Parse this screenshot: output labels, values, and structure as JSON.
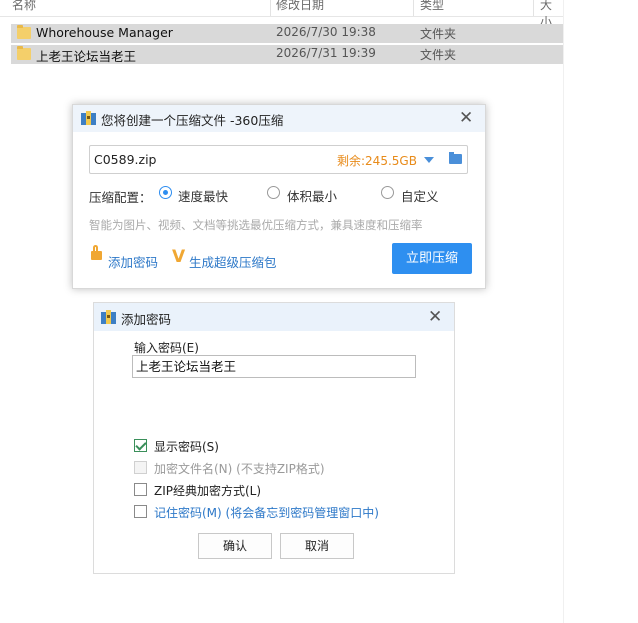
{
  "explorer": {
    "columns": [
      "名称",
      "修改日期",
      "类型",
      "大小"
    ],
    "rows": [
      {
        "name": "Whorehouse Manager",
        "date": "2026/7/30 19:38",
        "type": "文件夹"
      },
      {
        "name": "上老王论坛当老王",
        "date": "2026/7/31 19:39",
        "type": "文件夹"
      }
    ]
  },
  "compress_dialog": {
    "title": "您将创建一个压缩文件 -360压缩",
    "filename": "C0589.zip",
    "free_space": "剩余:245.5GB",
    "config_label": "压缩配置：",
    "options": [
      "速度最快",
      "体积最小",
      "自定义"
    ],
    "selected_option": "速度最快",
    "hint": "智能为图片、视频、文档等挑选最优压缩方式，兼具速度和压缩率",
    "add_password_link": "添加密码",
    "super_package_link": "生成超级压缩包",
    "compress_button": "立即压缩",
    "accent_color": "#2e8ff0",
    "warning_color": "#e88b1a"
  },
  "password_dialog": {
    "title": "添加密码",
    "input_label": "输入密码(E)",
    "password_value": "上老王论坛当老王",
    "checkboxes": [
      {
        "label": "显示密码(S)",
        "checked": true,
        "disabled": false
      },
      {
        "label": "加密文件名(N) (不支持ZIP格式)",
        "checked": false,
        "disabled": true
      },
      {
        "label": "ZIP经典加密方式(L)",
        "checked": false,
        "disabled": false
      },
      {
        "label": "记住密码(M) (将会备忘到密码管理窗口中)",
        "checked": false,
        "disabled": false
      }
    ],
    "ok_button": "确认",
    "cancel_button": "取消"
  }
}
